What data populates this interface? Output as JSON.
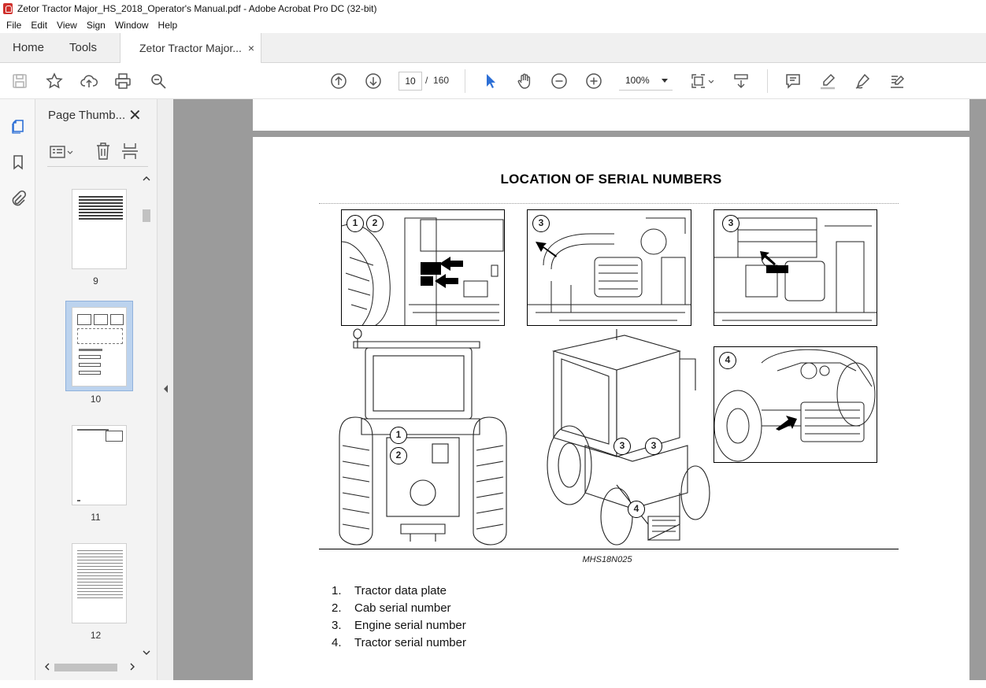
{
  "window": {
    "title": "Zetor Tractor Major_HS_2018_Operator's Manual.pdf - Adobe Acrobat Pro DC (32-bit)"
  },
  "menu": [
    "File",
    "Edit",
    "View",
    "Sign",
    "Window",
    "Help"
  ],
  "tabs": {
    "home": "Home",
    "tools": "Tools",
    "doc": "Zetor Tractor Major...",
    "doc_close": "×"
  },
  "toolbar": {
    "page_current": "10",
    "page_sep": "/",
    "page_total": "160",
    "zoom": "100%"
  },
  "panel": {
    "title": "Page Thumb...",
    "close": "✕",
    "thumbnails": [
      {
        "num": "9",
        "selected": false
      },
      {
        "num": "10",
        "selected": true
      },
      {
        "num": "11",
        "selected": false
      },
      {
        "num": "12",
        "selected": false
      }
    ]
  },
  "document": {
    "heading": "LOCATION OF SERIAL NUMBERS",
    "figure_code": "MHS18N025",
    "callouts": {
      "one": "1",
      "two": "2",
      "three": "3",
      "four": "4"
    },
    "legend": [
      {
        "num": "1.",
        "text": "Tractor data plate"
      },
      {
        "num": "2.",
        "text": "Cab serial number"
      },
      {
        "num": "3.",
        "text": "Engine serial number"
      },
      {
        "num": "4.",
        "text": "Tractor serial number"
      }
    ]
  },
  "colors": {
    "accent": "#2c6fd6",
    "brand": "#d0312d",
    "viewport": "#9b9b9b"
  }
}
